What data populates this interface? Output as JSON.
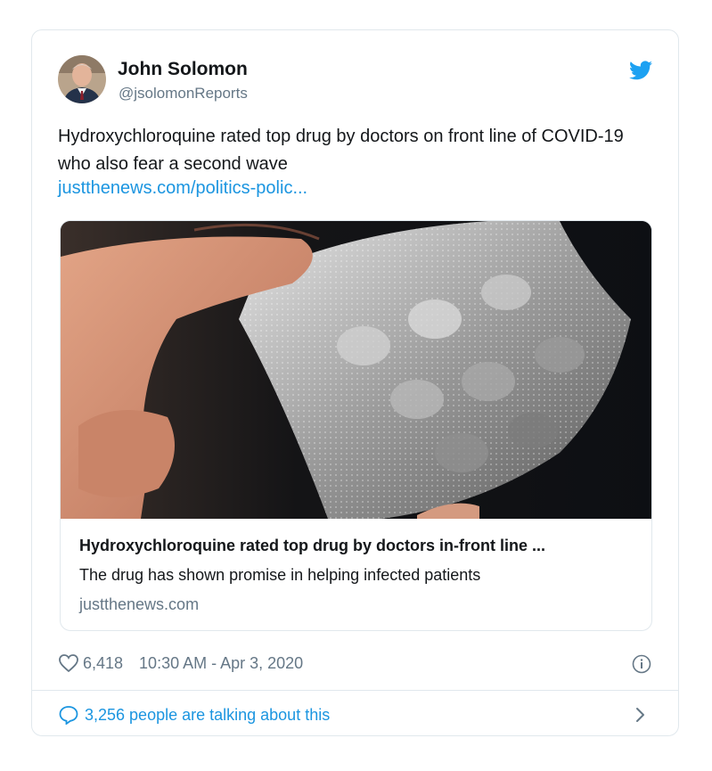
{
  "author": {
    "name": "John Solomon",
    "handle": "@jsolomonReports"
  },
  "tweet": {
    "text": "Hydroxychloroquine rated top drug by doctors on front line of COVID-19 who also fear a second wave",
    "link_text": "justthenews.com/politics-polic..."
  },
  "link_card": {
    "title": "Hydroxychloroquine rated top drug by doctors in-front line ...",
    "description": "The drug has shown promise in helping infected patients",
    "domain": "justthenews.com"
  },
  "meta": {
    "likes": "6,418",
    "timestamp": "10:30 AM - Apr 3, 2020"
  },
  "footer": {
    "talking_text": "3,256 people are talking about this"
  },
  "icons": {
    "brand": "twitter-bird-icon",
    "like": "heart-icon",
    "info": "info-icon",
    "reply": "speech-bubble-icon",
    "next": "chevron-right-icon"
  },
  "colors": {
    "brand": "#1da1f2",
    "link": "#1b95e0",
    "text": "#14171a",
    "muted": "#657786",
    "border": "#e1e8ed"
  }
}
